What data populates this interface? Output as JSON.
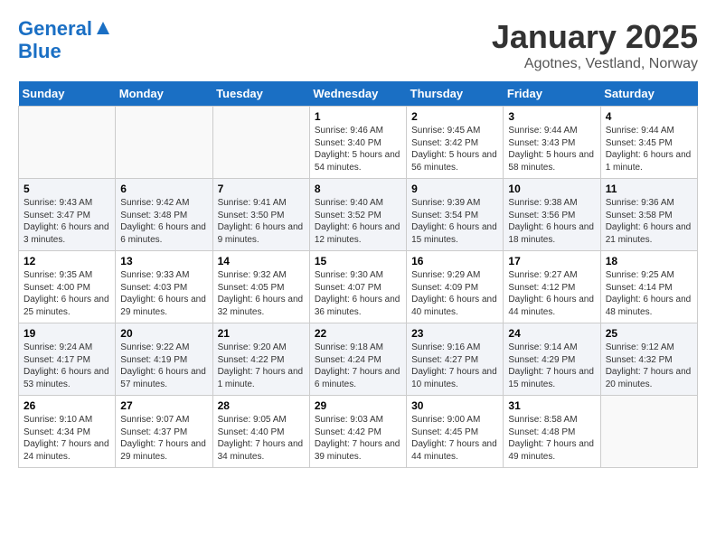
{
  "header": {
    "logo_line1": "General",
    "logo_line2": "Blue",
    "title": "January 2025",
    "subtitle": "Agotnes, Vestland, Norway"
  },
  "weekdays": [
    "Sunday",
    "Monday",
    "Tuesday",
    "Wednesday",
    "Thursday",
    "Friday",
    "Saturday"
  ],
  "weeks": [
    [
      {
        "day": "",
        "info": ""
      },
      {
        "day": "",
        "info": ""
      },
      {
        "day": "",
        "info": ""
      },
      {
        "day": "1",
        "info": "Sunrise: 9:46 AM\nSunset: 3:40 PM\nDaylight: 5 hours and 54 minutes."
      },
      {
        "day": "2",
        "info": "Sunrise: 9:45 AM\nSunset: 3:42 PM\nDaylight: 5 hours and 56 minutes."
      },
      {
        "day": "3",
        "info": "Sunrise: 9:44 AM\nSunset: 3:43 PM\nDaylight: 5 hours and 58 minutes."
      },
      {
        "day": "4",
        "info": "Sunrise: 9:44 AM\nSunset: 3:45 PM\nDaylight: 6 hours and 1 minute."
      }
    ],
    [
      {
        "day": "5",
        "info": "Sunrise: 9:43 AM\nSunset: 3:47 PM\nDaylight: 6 hours and 3 minutes."
      },
      {
        "day": "6",
        "info": "Sunrise: 9:42 AM\nSunset: 3:48 PM\nDaylight: 6 hours and 6 minutes."
      },
      {
        "day": "7",
        "info": "Sunrise: 9:41 AM\nSunset: 3:50 PM\nDaylight: 6 hours and 9 minutes."
      },
      {
        "day": "8",
        "info": "Sunrise: 9:40 AM\nSunset: 3:52 PM\nDaylight: 6 hours and 12 minutes."
      },
      {
        "day": "9",
        "info": "Sunrise: 9:39 AM\nSunset: 3:54 PM\nDaylight: 6 hours and 15 minutes."
      },
      {
        "day": "10",
        "info": "Sunrise: 9:38 AM\nSunset: 3:56 PM\nDaylight: 6 hours and 18 minutes."
      },
      {
        "day": "11",
        "info": "Sunrise: 9:36 AM\nSunset: 3:58 PM\nDaylight: 6 hours and 21 minutes."
      }
    ],
    [
      {
        "day": "12",
        "info": "Sunrise: 9:35 AM\nSunset: 4:00 PM\nDaylight: 6 hours and 25 minutes."
      },
      {
        "day": "13",
        "info": "Sunrise: 9:33 AM\nSunset: 4:03 PM\nDaylight: 6 hours and 29 minutes."
      },
      {
        "day": "14",
        "info": "Sunrise: 9:32 AM\nSunset: 4:05 PM\nDaylight: 6 hours and 32 minutes."
      },
      {
        "day": "15",
        "info": "Sunrise: 9:30 AM\nSunset: 4:07 PM\nDaylight: 6 hours and 36 minutes."
      },
      {
        "day": "16",
        "info": "Sunrise: 9:29 AM\nSunset: 4:09 PM\nDaylight: 6 hours and 40 minutes."
      },
      {
        "day": "17",
        "info": "Sunrise: 9:27 AM\nSunset: 4:12 PM\nDaylight: 6 hours and 44 minutes."
      },
      {
        "day": "18",
        "info": "Sunrise: 9:25 AM\nSunset: 4:14 PM\nDaylight: 6 hours and 48 minutes."
      }
    ],
    [
      {
        "day": "19",
        "info": "Sunrise: 9:24 AM\nSunset: 4:17 PM\nDaylight: 6 hours and 53 minutes."
      },
      {
        "day": "20",
        "info": "Sunrise: 9:22 AM\nSunset: 4:19 PM\nDaylight: 6 hours and 57 minutes."
      },
      {
        "day": "21",
        "info": "Sunrise: 9:20 AM\nSunset: 4:22 PM\nDaylight: 7 hours and 1 minute."
      },
      {
        "day": "22",
        "info": "Sunrise: 9:18 AM\nSunset: 4:24 PM\nDaylight: 7 hours and 6 minutes."
      },
      {
        "day": "23",
        "info": "Sunrise: 9:16 AM\nSunset: 4:27 PM\nDaylight: 7 hours and 10 minutes."
      },
      {
        "day": "24",
        "info": "Sunrise: 9:14 AM\nSunset: 4:29 PM\nDaylight: 7 hours and 15 minutes."
      },
      {
        "day": "25",
        "info": "Sunrise: 9:12 AM\nSunset: 4:32 PM\nDaylight: 7 hours and 20 minutes."
      }
    ],
    [
      {
        "day": "26",
        "info": "Sunrise: 9:10 AM\nSunset: 4:34 PM\nDaylight: 7 hours and 24 minutes."
      },
      {
        "day": "27",
        "info": "Sunrise: 9:07 AM\nSunset: 4:37 PM\nDaylight: 7 hours and 29 minutes."
      },
      {
        "day": "28",
        "info": "Sunrise: 9:05 AM\nSunset: 4:40 PM\nDaylight: 7 hours and 34 minutes."
      },
      {
        "day": "29",
        "info": "Sunrise: 9:03 AM\nSunset: 4:42 PM\nDaylight: 7 hours and 39 minutes."
      },
      {
        "day": "30",
        "info": "Sunrise: 9:00 AM\nSunset: 4:45 PM\nDaylight: 7 hours and 44 minutes."
      },
      {
        "day": "31",
        "info": "Sunrise: 8:58 AM\nSunset: 4:48 PM\nDaylight: 7 hours and 49 minutes."
      },
      {
        "day": "",
        "info": ""
      }
    ]
  ]
}
